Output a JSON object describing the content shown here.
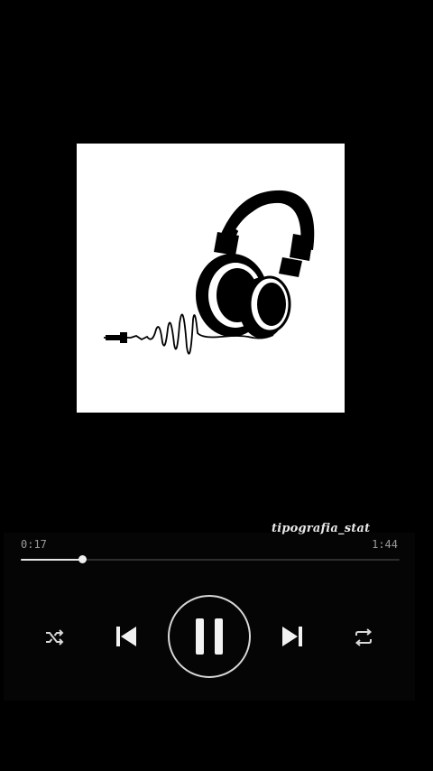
{
  "app": {
    "theme_background": "#000000",
    "accent": "#e6e6e6"
  },
  "artwork": {
    "icon": "headphones-icon",
    "background": "#ffffff"
  },
  "watermark": {
    "text": "tipografia_stat"
  },
  "playback": {
    "elapsed": "0:17",
    "total": "1:44",
    "progress_fraction": 0.162
  },
  "controls": {
    "shuffle": {
      "icon": "shuffle-icon"
    },
    "previous": {
      "icon": "skip-previous-icon"
    },
    "play_pause": {
      "icon": "pause-icon",
      "state": "playing"
    },
    "next": {
      "icon": "skip-next-icon"
    },
    "repeat": {
      "icon": "repeat-icon"
    }
  }
}
